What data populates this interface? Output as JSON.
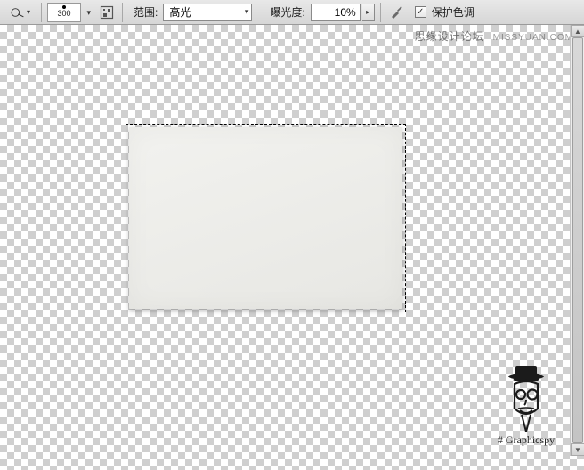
{
  "toolbar": {
    "brush": {
      "size": "300"
    },
    "range": {
      "label": "范围:",
      "value": "高光"
    },
    "exposure": {
      "label": "曝光度:",
      "value": "10%"
    },
    "protect_tones": {
      "label": "保护色调",
      "checked": true
    }
  },
  "watermark": {
    "text1": "思缘设计论坛",
    "text2": "MISSYUAN.COM"
  },
  "credit": {
    "name": "# Graphicspy"
  }
}
